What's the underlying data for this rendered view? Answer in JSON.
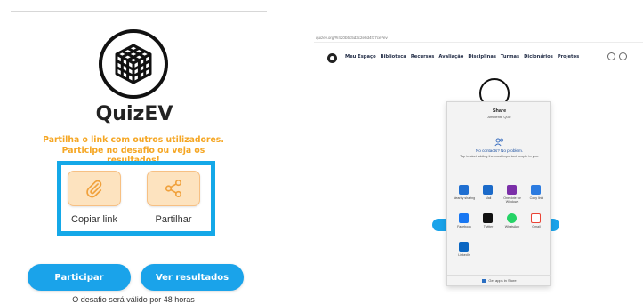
{
  "left": {
    "app_title": "QuizEV",
    "message_line1": "Partilha o link com outros utilizadores.",
    "message_line2": "Participe no desafio ou veja os resultados!",
    "copy_label": "Copiar link",
    "share_label": "Partilhar",
    "participate_label": "Participar",
    "results_label": "Ver resultados",
    "validity_text": "O desafio será válido por 48 horas",
    "colors": {
      "accent_orange": "#f5a623",
      "highlight_blue": "#14a8e8",
      "button_blue": "#1aa3ea",
      "option_bg": "#fde3bf"
    },
    "icons": [
      "paperclip-icon",
      "share-nodes-icon",
      "rubiks-cube-logo"
    ]
  },
  "right": {
    "url": "quizev.org/#/420b5c5d3c2e8d4f17ce?ev",
    "nav": [
      "Meu Espaço",
      "Biblioteca",
      "Recursos",
      "Avaliação",
      "Disciplinas",
      "Turmas",
      "Dicionários",
      "Projetos"
    ],
    "share_dialog": {
      "title": "Share",
      "subtitle": "Ambiente Quiz",
      "no_contacts_title": "No contacts? No problem.",
      "no_contacts_sub": "Tap to start adding the most important people to you.",
      "apps": [
        {
          "label": "Nearby sharing",
          "icon": "nearby-share-icon",
          "color": "#1f6fd1"
        },
        {
          "label": "Mail",
          "icon": "mail-icon",
          "color": "#1b6ac9"
        },
        {
          "label": "OneNote for Windows",
          "icon": "onenote-icon",
          "color": "#7b2fa8"
        },
        {
          "label": "Copy link",
          "icon": "copy-link-icon",
          "color": "#2b7be0"
        },
        {
          "label": "Facebook",
          "icon": "facebook-icon",
          "color": "#1877f2"
        },
        {
          "label": "Twitter",
          "icon": "twitter-icon",
          "color": "#111111"
        },
        {
          "label": "WhatsApp",
          "icon": "whatsapp-icon",
          "color": "#25d366"
        },
        {
          "label": "Gmail",
          "icon": "gmail-icon",
          "color": "#ea4335"
        },
        {
          "label": "LinkedIn",
          "icon": "linkedin-icon",
          "color": "#0a66c2"
        }
      ],
      "footer": "Get apps in Store"
    }
  }
}
